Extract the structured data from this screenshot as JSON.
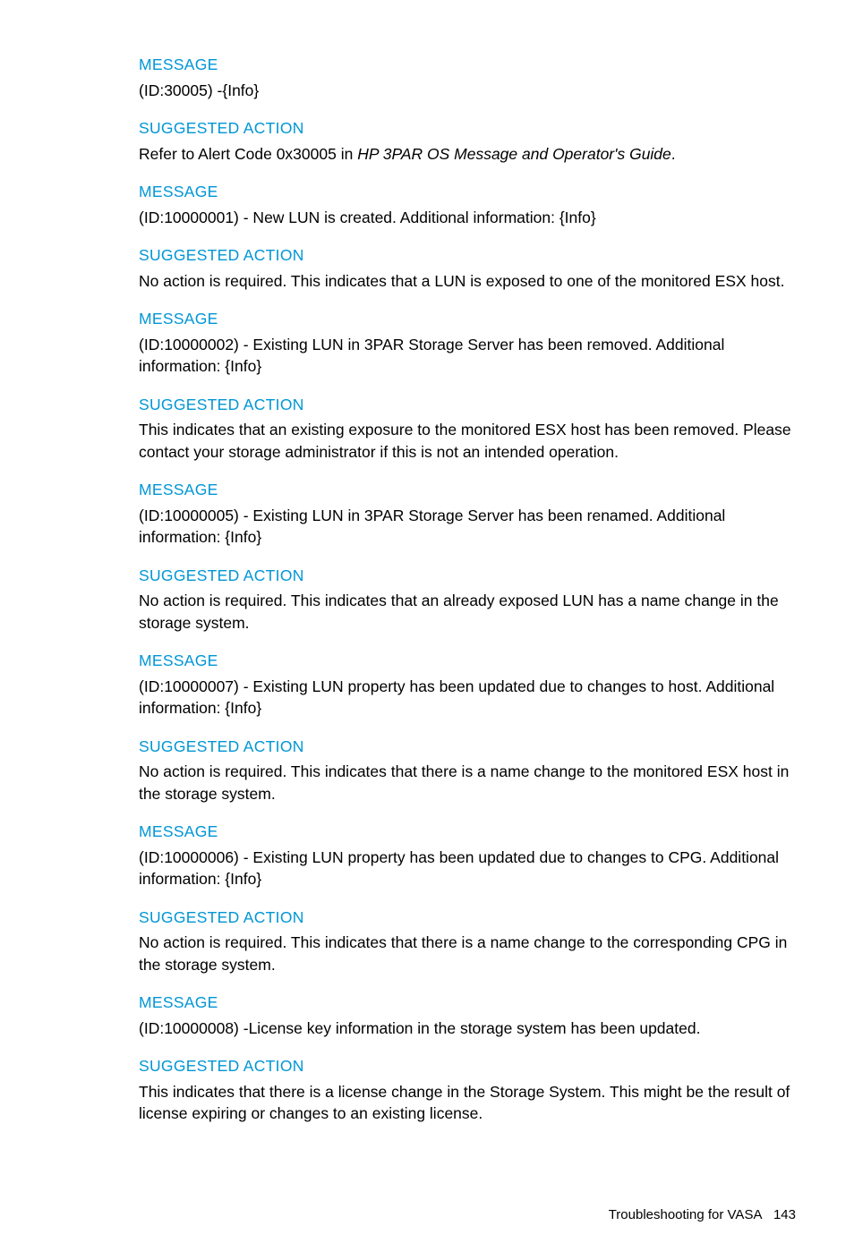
{
  "sections": [
    {
      "heading": "MESSAGE",
      "body": "(ID:30005) -{Info}"
    },
    {
      "heading": "SUGGESTED ACTION",
      "body_prefix": "Refer to Alert Code 0x30005 in ",
      "body_italic": "HP 3PAR OS Message and Operator's Guide",
      "body_suffix": "."
    },
    {
      "heading": "MESSAGE",
      "body": "(ID:10000001) - New LUN is created. Additional information: {Info}"
    },
    {
      "heading": "SUGGESTED ACTION",
      "body": "No action is required. This indicates that a LUN is exposed to one of the monitored ESX host."
    },
    {
      "heading": "MESSAGE",
      "body": "(ID:10000002) - Existing LUN in 3PAR Storage Server has been removed. Additional information: {Info}"
    },
    {
      "heading": "SUGGESTED ACTION",
      "body": "This indicates that an existing exposure to the monitored ESX host has been removed. Please contact your storage administrator if this is not an intended operation."
    },
    {
      "heading": "MESSAGE",
      "body": "(ID:10000005) - Existing LUN in 3PAR Storage Server has been renamed. Additional information: {Info}"
    },
    {
      "heading": "SUGGESTED ACTION",
      "body": "No action is required. This indicates that an already exposed LUN has a name change in the storage system."
    },
    {
      "heading": "MESSAGE",
      "body": "(ID:10000007) - Existing LUN property has been updated due to changes to host. Additional information: {Info}"
    },
    {
      "heading": "SUGGESTED ACTION",
      "body": "No action is required. This indicates that there is a name change to the monitored ESX host in the storage system."
    },
    {
      "heading": "MESSAGE",
      "body": "(ID:10000006) - Existing LUN property has been updated due to changes to CPG. Additional information: {Info}"
    },
    {
      "heading": "SUGGESTED ACTION",
      "body": "No action is required. This indicates that there is a name change to the corresponding CPG in the storage system."
    },
    {
      "heading": "MESSAGE",
      "body": "(ID:10000008) -License key information in the storage system has been updated."
    },
    {
      "heading": "SUGGESTED ACTION",
      "body": "This indicates that there is a license change in the Storage System. This might be the result of license expiring or changes to an existing license."
    }
  ],
  "footer": {
    "title": "Troubleshooting for VASA",
    "page": "143"
  }
}
